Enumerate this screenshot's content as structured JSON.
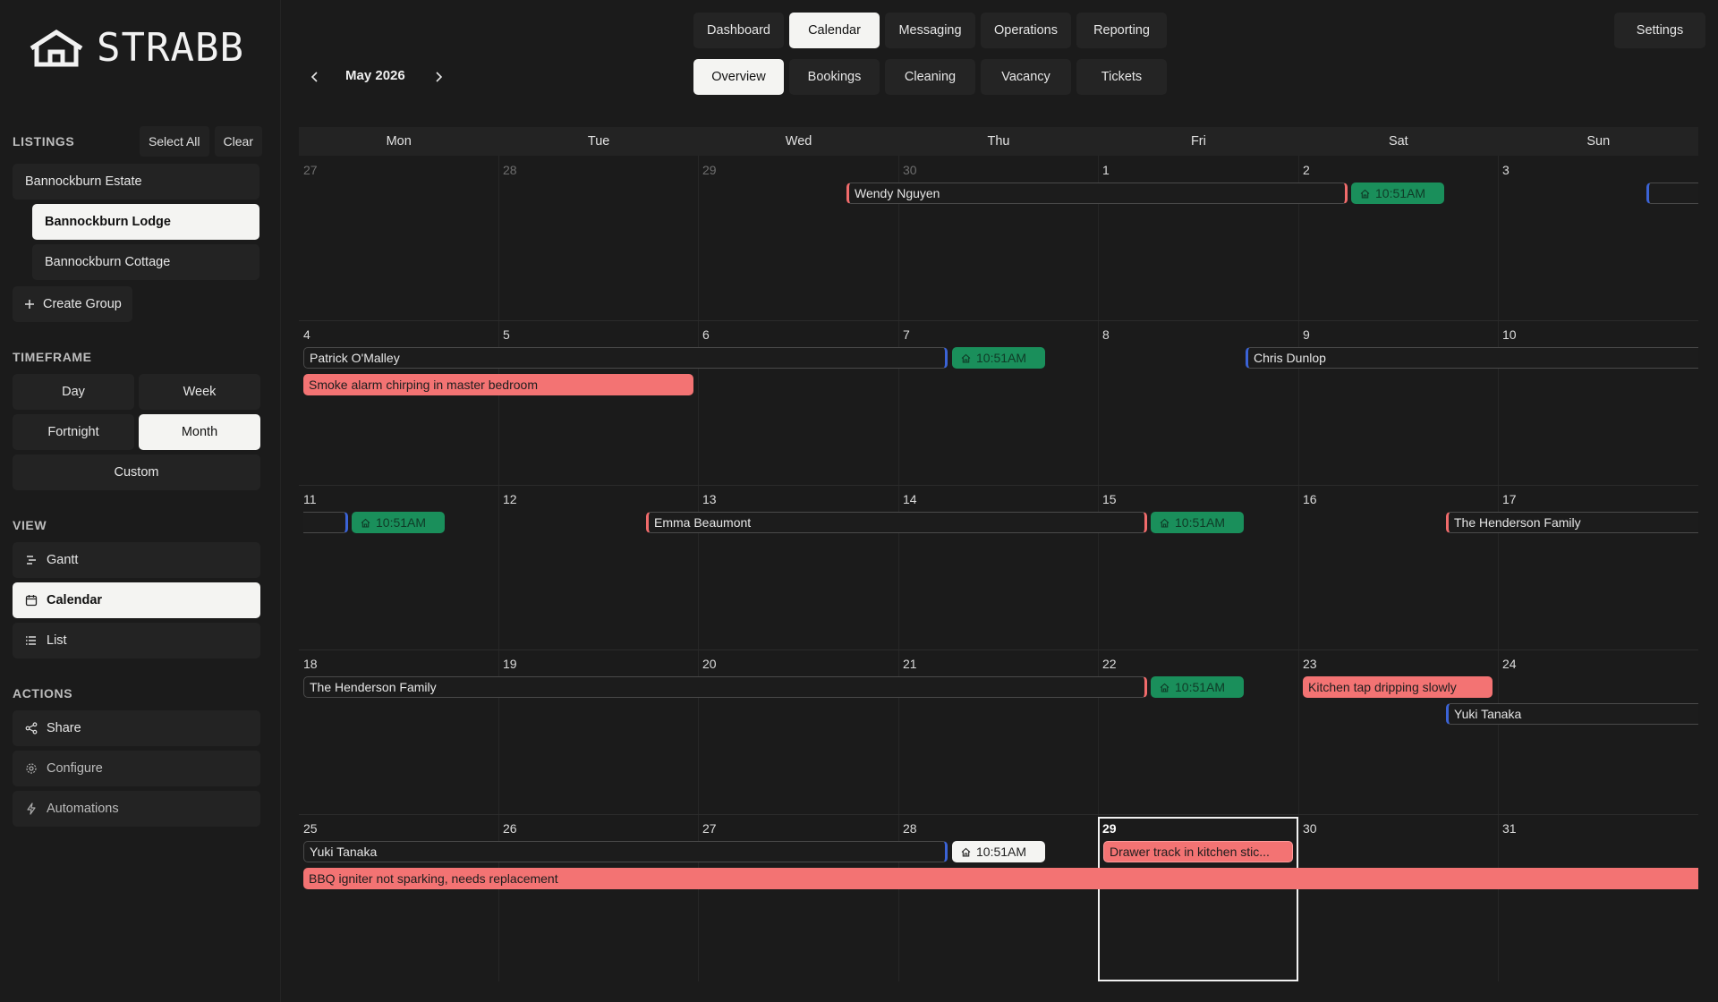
{
  "brand": {
    "name": "STRABB"
  },
  "top_nav": {
    "main_tabs": [
      "Dashboard",
      "Calendar",
      "Messaging",
      "Operations",
      "Reporting"
    ],
    "active_main": "Calendar",
    "sub_tabs": [
      "Overview",
      "Bookings",
      "Cleaning",
      "Vacancy",
      "Tickets"
    ],
    "active_sub": "Overview",
    "settings_label": "Settings",
    "month_label": "May 2026"
  },
  "sidebar": {
    "listings": {
      "heading": "LISTINGS",
      "select_all": "Select All",
      "clear": "Clear",
      "group": "Bannockburn Estate",
      "items": [
        "Bannockburn Lodge",
        "Bannockburn Cottage"
      ],
      "active_item": "Bannockburn Lodge",
      "create_group": "Create Group"
    },
    "timeframe": {
      "heading": "TIMEFRAME",
      "options": [
        "Day",
        "Week",
        "Fortnight",
        "Month",
        "Custom"
      ],
      "active": "Month"
    },
    "view": {
      "heading": "VIEW",
      "options": [
        "Gantt",
        "Calendar",
        "List"
      ],
      "active": "Calendar"
    },
    "actions": {
      "heading": "ACTIONS",
      "items": [
        "Share",
        "Configure",
        "Automations"
      ]
    }
  },
  "calendar": {
    "weekdays": [
      "Mon",
      "Tue",
      "Wed",
      "Thu",
      "Fri",
      "Sat",
      "Sun"
    ],
    "weeks": [
      [
        "27",
        "28",
        "29",
        "30",
        "1",
        "2",
        "3"
      ],
      [
        "4",
        "5",
        "6",
        "7",
        "8",
        "9",
        "10"
      ],
      [
        "11",
        "12",
        "13",
        "14",
        "15",
        "16",
        "17"
      ],
      [
        "18",
        "19",
        "20",
        "21",
        "22",
        "23",
        "24"
      ],
      [
        "25",
        "26",
        "27",
        "28",
        "29",
        "30",
        "31"
      ]
    ],
    "today": "29",
    "checkin_time": "10:51AM",
    "bookings": {
      "wendy": "Wendy Nguyen",
      "patrick": "Patrick O'Malley",
      "chris": "Chris Dunlop",
      "emma": "Emma Beaumont",
      "henderson_1": "The Henderson Family",
      "henderson_2": "The Henderson Family",
      "yuki_1": "Yuki Tanaka",
      "yuki_2": "Yuki Tanaka"
    },
    "issues": {
      "smoke": "Smoke alarm chirping in master bedroom",
      "tap": "Kitchen tap dripping slowly",
      "drawer": "Drawer track in kitchen stic...",
      "bbq": "BBQ igniter not sparking, needs replacement"
    }
  }
}
